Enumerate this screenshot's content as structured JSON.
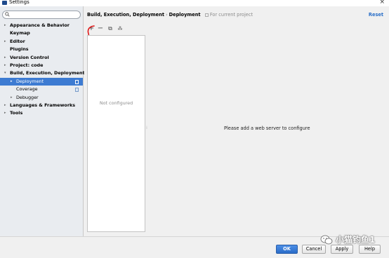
{
  "window": {
    "title": "Settings",
    "close_glyph": "×"
  },
  "sidebar": {
    "search": {
      "placeholder": "",
      "value": ""
    },
    "items": [
      {
        "label": "Appearance & Behavior",
        "level": 0,
        "arrow": "▸",
        "bold": true
      },
      {
        "label": "Keymap",
        "level": 0,
        "arrow": "",
        "bold": true
      },
      {
        "label": "Editor",
        "level": 0,
        "arrow": "▸",
        "bold": true
      },
      {
        "label": "Plugins",
        "level": 0,
        "arrow": "",
        "bold": true
      },
      {
        "label": "Version Control",
        "level": 0,
        "arrow": "▸",
        "bold": true
      },
      {
        "label": "Project: code",
        "level": 0,
        "arrow": "▸",
        "bold": true
      },
      {
        "label": "Build, Execution, Deployment",
        "level": 0,
        "arrow": "▾",
        "bold": true
      },
      {
        "label": "Deployment",
        "level": 1,
        "arrow": "▸",
        "bold": false,
        "selected": true,
        "page_icon": true
      },
      {
        "label": "Coverage",
        "level": 1,
        "arrow": "",
        "bold": false,
        "page_icon": true
      },
      {
        "label": "Debugger",
        "level": 1,
        "arrow": "▸",
        "bold": false
      },
      {
        "label": "Languages & Frameworks",
        "level": 0,
        "arrow": "▸",
        "bold": true
      },
      {
        "label": "Tools",
        "level": 0,
        "arrow": "▸",
        "bold": true
      }
    ]
  },
  "header": {
    "crumb_parent": "Build, Execution, Deployment",
    "crumb_separator": "›",
    "crumb_current": "Deployment",
    "scope_label": "For current project",
    "reset_label": "Reset"
  },
  "toolbar": {
    "add_glyph": "+",
    "remove_glyph": "−",
    "copy_glyph": "⧉",
    "extra_glyph": "⁂",
    "annotation_color": "#e01818"
  },
  "server_list": {
    "empty_text": "Not configured"
  },
  "detail": {
    "hint_text": "Please add a web server to configure"
  },
  "footer": {
    "ok_label": "OK",
    "cancel_label": "Cancel",
    "apply_label": "Apply",
    "help_label": "Help"
  },
  "watermark": {
    "text": "小猫钓鱼1"
  },
  "colors": {
    "accent": "#3d7bd2",
    "link": "#2a6fc8",
    "sidebar_bg": "#e9ecf0"
  }
}
